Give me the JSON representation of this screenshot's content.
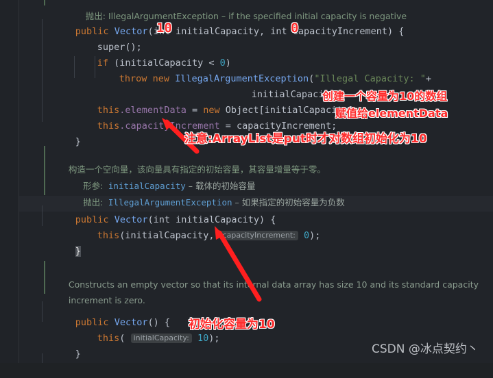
{
  "editor": {
    "theme_bg": "#212429",
    "gutter_bg": "#202328",
    "current_line_bg": "#26292f",
    "lines": {
      "l0_doc_throws_cut": "抛出: IllegalArgumentException – if the specified initial capacity is negative",
      "l1_kw_public": "public",
      "l1_type": "Vector",
      "l1_sig": "(int initialCapacity, int capacityIncrement) {",
      "l2": "super();",
      "l3_kw_if": "if",
      "l3_rest": " (initialCapacity < ",
      "l3_num": "0",
      "l3_tail": ")",
      "l4_kw_throw": "throw",
      "l4_kw_new": "new",
      "l4_type": "IllegalArgumentException",
      "l4_paren": "(",
      "l4_str": "\"Illegal Capacity: \"",
      "l4_plus": "+",
      "l5": "initialCapacity);",
      "l6_this": "this",
      "l6_field": ".elementData",
      "l6_eq": " = ",
      "l6_new": "new",
      "l6_obj": " Object[initialCapacity];",
      "l7_this": "this",
      "l7_field": ".capacityIncrement",
      "l7_rest": " = capacityIncrement;",
      "l8_close": "}",
      "l10_doc_cn": "构造一个空向量，该向量具有指定的初始容量，其容量增量等于零。",
      "l11_doc_label": "形参:",
      "l11_doc_tag": "initialCapacity",
      "l11_doc_dash": "–",
      "l11_doc_text": "载体的初始容量",
      "l12_doc_label": "抛出:",
      "l12_doc_tag": "IllegalArgumentException",
      "l12_doc_dash": "–",
      "l12_doc_text": "如果指定的初始容量为负数",
      "l13_kw_public": "public",
      "l13_type": "Vector",
      "l13_sig": "(int initialCapacity) {",
      "l14_this": "this",
      "l14_open": "(initialCapacity, ",
      "l14_hint": "capacityIncrement:",
      "l14_num": "0",
      "l14_tail": ");",
      "l15_close": "}",
      "l17_doc_en_1": "Constructs an empty vector so that its internal data array has size 10 and its standard capacity",
      "l17_doc_en_2": "increment is zero.",
      "l19_kw_public": "public",
      "l19_type": "Vector",
      "l19_sig": "() {",
      "l20_this": "this",
      "l20_open": "( ",
      "l20_hint": "initialCapacity:",
      "l20_num": "10",
      "l20_tail": ");",
      "l21_close": "}"
    }
  },
  "annotations": {
    "color": "#ff2d2d",
    "outline": "#ffffff",
    "num_10_top": "10",
    "num_0_top": "0",
    "note_create_array": "创建一个容量为10的数组",
    "note_assign": "赋值给elementData",
    "note_arraylist": "注意:ArrayList是put时才对数组初始化为10",
    "note_init_cap": "初始化容量为10"
  },
  "watermark": {
    "text": "CSDN @冰点契约丶"
  }
}
